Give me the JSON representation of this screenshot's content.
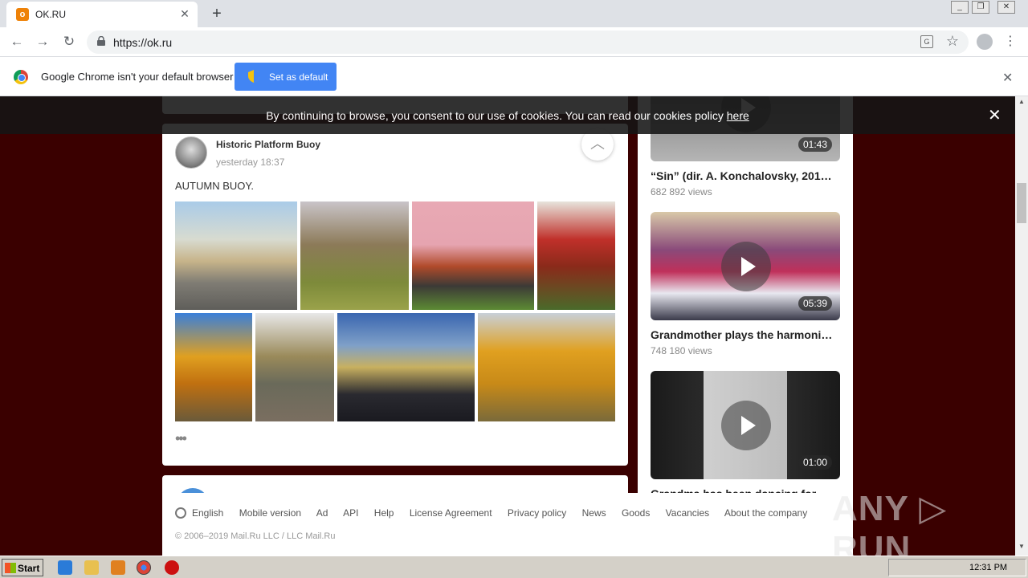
{
  "browser": {
    "tab_title": "OK.RU",
    "url": "https://ok.ru",
    "infobar_message": "Google Chrome isn't your default browser",
    "set_default_label": "Set as default"
  },
  "cookie": {
    "text": "By continuing to browse, you consent to our use of cookies. You can read our cookies policy ",
    "link": "here"
  },
  "post": {
    "author": "Historic Platform Buoy",
    "time": "yesterday 18:37",
    "text": "AUTUMN BUOY."
  },
  "videos": [
    {
      "duration": "01:43",
      "title": "“Sin” (dir. A. Konchalovsky, 201…",
      "views": "682 892 views"
    },
    {
      "duration": "05:39",
      "title": "Grandmother plays the harmoni…",
      "views": "748 180 views"
    },
    {
      "duration": "01:00",
      "title": "Grandma has been dancing for…",
      "views": ""
    }
  ],
  "footer": {
    "links": [
      "English",
      "Mobile version",
      "Ad",
      "API",
      "Help",
      "License Agreement",
      "Privacy policy",
      "News",
      "Goods",
      "Vacancies",
      "About the company"
    ],
    "copyright": "© 2006–2019 Mail.Ru LLC / LLC Mail.Ru"
  },
  "watermark": "ANY ▷ RUN",
  "taskbar": {
    "start_label": "Start",
    "clock": "12:31 PM"
  },
  "colors": {
    "page_bg": "#3a0000",
    "accent_button": "#4285f4",
    "ok_orange": "#ee8208"
  }
}
